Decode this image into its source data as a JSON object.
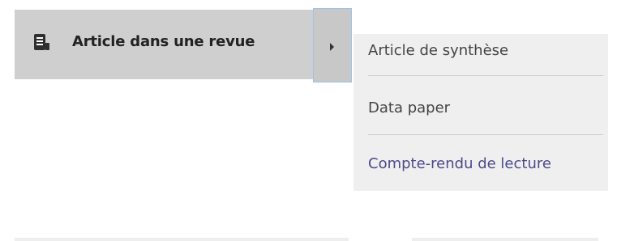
{
  "menu": {
    "main_item": {
      "label": "Article dans une revue",
      "icon": "document-icon"
    },
    "expand_icon": "caret-right-icon",
    "submenu": [
      {
        "label": "Article de synthèse"
      },
      {
        "label": "Data paper"
      },
      {
        "label": "Compte-rendu de lecture"
      }
    ]
  },
  "colors": {
    "selected_bg": "#cfcfcf",
    "submenu_bg": "#efefef",
    "link_text": "#4c4a8a",
    "focus_border": "#9ec2e6"
  }
}
